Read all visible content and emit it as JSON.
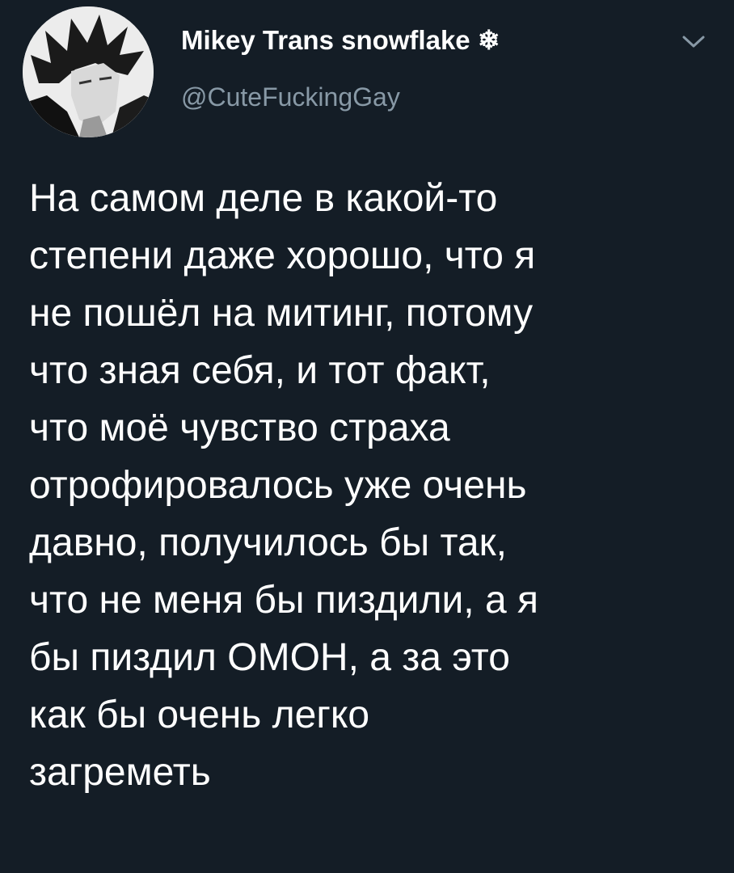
{
  "tweet": {
    "author": {
      "display_name": "Mikey Trans snowflake ❄",
      "handle": "@CuteFuckingGay",
      "avatar_icon": "user-avatar-icon"
    },
    "menu_icon": "chevron-down-icon",
    "text": "На самом деле в какой-то\nстепени даже хорошо, что я\nне пошёл на митинг, потому\nчто зная себя, и тот факт,\nчто моё чувство страха\nотрофировалось уже очень\nдавно, получилось бы так,\nчто не меня бы пиздили, а я\nбы пиздил ОМОН, а за это\nкак бы очень легко\nзагреметь"
  },
  "colors": {
    "background": "#141d26",
    "text": "#ffffff",
    "secondary_text": "#8899a6"
  }
}
